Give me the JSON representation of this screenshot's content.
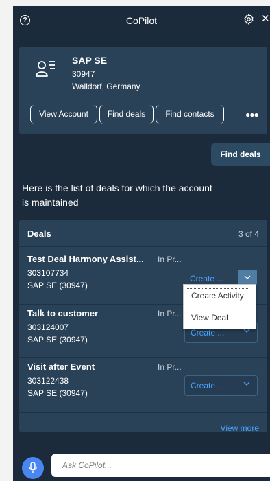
{
  "header": {
    "title": "CoPilot",
    "help_icon": "help-circle-icon",
    "settings_icon": "gear-icon",
    "close_icon": "close-icon"
  },
  "account": {
    "icon": "account-list-icon",
    "name": "SAP SE",
    "id": "30947",
    "location": "Walldorf, Germany",
    "actions": [
      "View Account",
      "Find deals",
      "Find contacts"
    ],
    "more_icon": "more-icon"
  },
  "user_message": "Find deals",
  "bot_message": "Here is the list of deals for which the account is maintained",
  "deals": {
    "title": "Deals",
    "count": "3 of 4",
    "items": [
      {
        "name": "Test Deal Harmony Assist...",
        "status": "In Pr...",
        "id": "303107734",
        "account": "SAP SE (30947)",
        "action": "Create ..."
      },
      {
        "name": "Talk to customer",
        "status": "In Pr...",
        "id": "303124007",
        "account": "SAP SE (30947)",
        "action": "Create ..."
      },
      {
        "name": "Visit after Event",
        "status": "In Pr...",
        "id": "303122438",
        "account": "SAP SE (30947)",
        "action": "Create ..."
      }
    ],
    "view_more": "View more"
  },
  "dropdown": {
    "items": [
      "Create Activity",
      "View Deal"
    ]
  },
  "input": {
    "placeholder": "Ask CoPilot...",
    "mic_icon": "microphone-icon"
  },
  "colors": {
    "panel_bg": "#1c2b3c",
    "card_bg": "#2a4258",
    "accent": "#4aa3ff",
    "mic": "#4a86f0"
  }
}
